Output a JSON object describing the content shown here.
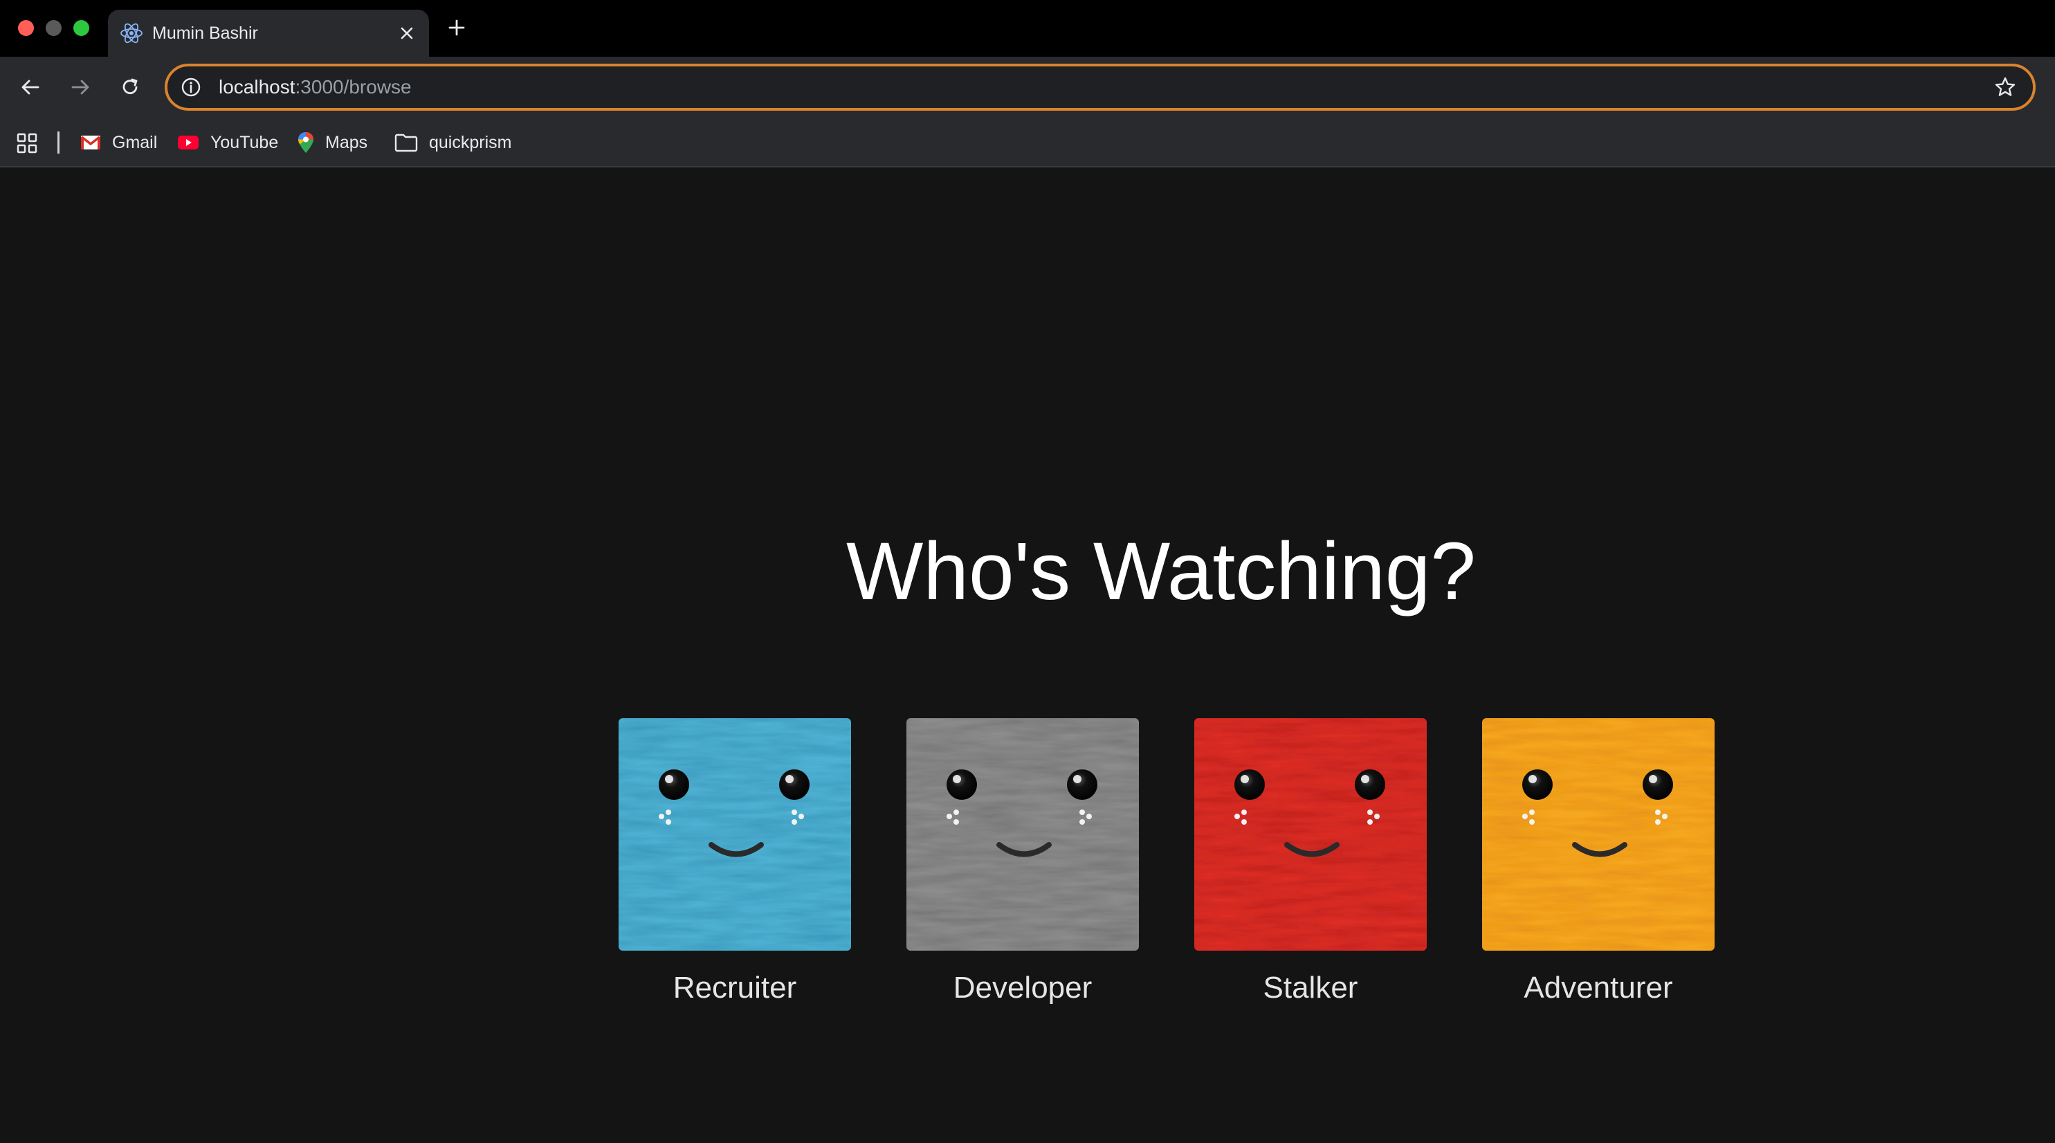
{
  "browser": {
    "tab": {
      "title": "Mumin Bashir",
      "favicon": "react-atom-icon"
    },
    "address": {
      "host": "localhost",
      "path": ":3000/browse"
    },
    "bookmarks": [
      {
        "label": "Gmail",
        "icon": "gmail-icon"
      },
      {
        "label": "YouTube",
        "icon": "youtube-icon"
      },
      {
        "label": "Maps",
        "icon": "maps-pin-icon"
      },
      {
        "label": "quickprism",
        "icon": "folder-icon"
      }
    ],
    "colors": {
      "omnibox_focus_ring": "#d9832f",
      "tab_bg": "#282a2d"
    }
  },
  "page": {
    "heading": "Who's Watching?",
    "profiles": [
      {
        "name": "Recruiter",
        "color": "#4fb1d3",
        "fur_dark": "#2c8aae"
      },
      {
        "name": "Developer",
        "color": "#8c8c8c",
        "fur_dark": "#666666"
      },
      {
        "name": "Stalker",
        "color": "#dc2e28",
        "fur_dark": "#b01d18"
      },
      {
        "name": "Adventurer",
        "color": "#f5a723",
        "fur_dark": "#e08412"
      }
    ],
    "background": "#141414"
  }
}
